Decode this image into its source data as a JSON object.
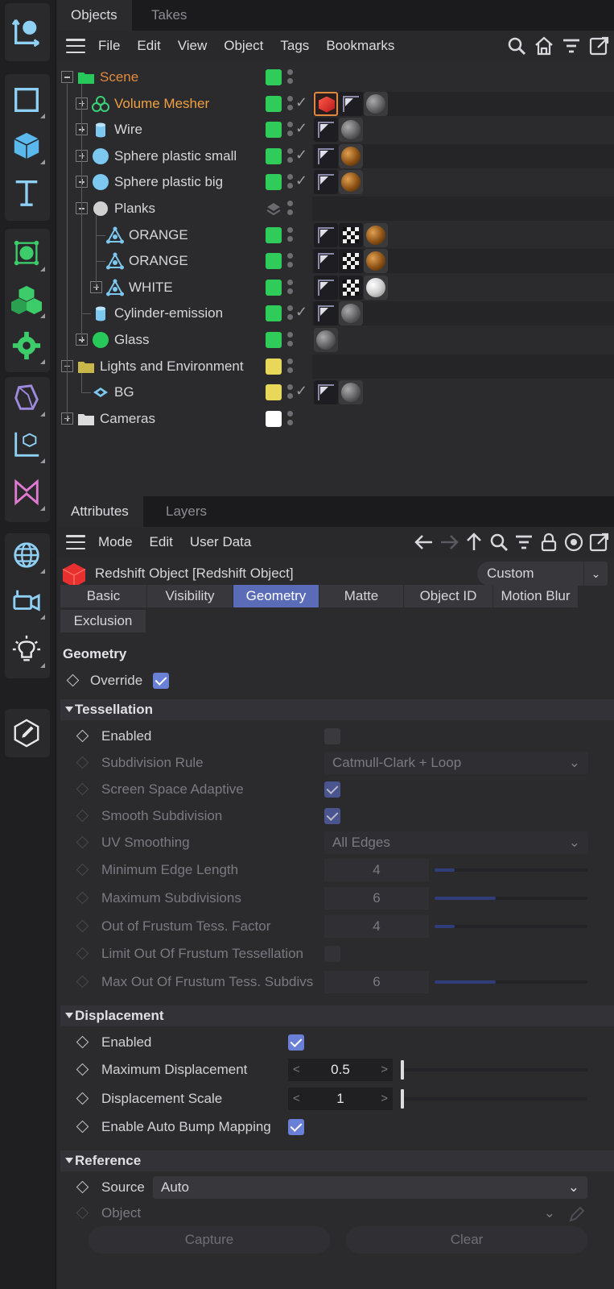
{
  "object_manager": {
    "tabs": [
      "Objects",
      "Takes"
    ],
    "menu": [
      "File",
      "Edit",
      "View",
      "Object",
      "Tags",
      "Bookmarks"
    ],
    "objects": [
      {
        "name": "Scene",
        "depth": 0,
        "expander": "minus",
        "icon": "folder-icon",
        "icon_color": "#27c95a",
        "name_color": "#e08a3c",
        "layer_color": "#2fcc5a",
        "check": false,
        "tags": [],
        "striped": false
      },
      {
        "name": "Volume Mesher",
        "depth": 1,
        "expander": "plus",
        "icon": "volume-mesher-icon",
        "icon_color": "#3cd07a",
        "name_color": "#f0a040",
        "layer_color": "#2fcc5a",
        "check": true,
        "tags": [
          "red-cube",
          "phong",
          "grey-material"
        ],
        "striped": true
      },
      {
        "name": "Wire",
        "depth": 1,
        "expander": "plus",
        "icon": "cylinder-icon",
        "icon_color": "#7cc8f0",
        "name_color": "#d6d6da",
        "layer_color": "#2fcc5a",
        "check": true,
        "tags": [
          "phong",
          "grey-material"
        ],
        "striped": false
      },
      {
        "name": "Sphere plastic small",
        "depth": 1,
        "expander": "plus",
        "icon": "sphere-icon",
        "icon_color": "#7cc8f0",
        "name_color": "#d6d6da",
        "layer_color": "#2fcc5a",
        "check": true,
        "tags": [
          "phong",
          "brown-material"
        ],
        "striped": true
      },
      {
        "name": "Sphere plastic big",
        "depth": 1,
        "expander": "plus",
        "icon": "sphere-icon",
        "icon_color": "#7cc8f0",
        "name_color": "#d6d6da",
        "layer_color": "#2fcc5a",
        "check": true,
        "tags": [
          "phong",
          "brown-material"
        ],
        "striped": false
      },
      {
        "name": "Planks",
        "depth": 1,
        "expander": "minus",
        "icon": "null-icon",
        "icon_color": "#d0d0d0",
        "name_color": "#d6d6da",
        "layer_color": "layers",
        "check": false,
        "tags": [],
        "striped": true
      },
      {
        "name": "ORANGE",
        "depth": 2,
        "expander": "none",
        "icon": "polygon-icon",
        "icon_color": "#7cc8f0",
        "name_color": "#d6d6da",
        "layer_color": "#2fcc5a",
        "check": false,
        "tags": [
          "phong",
          "checker",
          "brown-material"
        ],
        "striped": false
      },
      {
        "name": "ORANGE",
        "depth": 2,
        "expander": "none",
        "icon": "polygon-icon",
        "icon_color": "#7cc8f0",
        "name_color": "#d6d6da",
        "layer_color": "#2fcc5a",
        "check": false,
        "tags": [
          "phong",
          "checker",
          "brown-material"
        ],
        "striped": true
      },
      {
        "name": "WHITE",
        "depth": 2,
        "expander": "plus",
        "icon": "polygon-icon",
        "icon_color": "#7cc8f0",
        "name_color": "#d6d6da",
        "layer_color": "#2fcc5a",
        "check": false,
        "tags": [
          "phong",
          "checker",
          "white-material"
        ],
        "striped": false
      },
      {
        "name": "Cylinder-emission",
        "depth": 1,
        "expander": "none",
        "icon": "cylinder-icon",
        "icon_color": "#7cc8f0",
        "name_color": "#d6d6da",
        "layer_color": "#2fcc5a",
        "check": true,
        "tags": [
          "phong",
          "grey-material"
        ],
        "striped": true
      },
      {
        "name": "Glass",
        "depth": 1,
        "expander": "plus",
        "icon": "sphere-icon",
        "icon_color": "#27c95a",
        "name_color": "#d6d6da",
        "layer_color": "#2fcc5a",
        "check": false,
        "tags": [
          "grey-material"
        ],
        "striped": false
      },
      {
        "name": "Lights and Environment",
        "depth": 0,
        "expander": "minus",
        "icon": "folder-icon",
        "icon_color": "#c8b84a",
        "name_color": "#d6d6da",
        "layer_color": "#e8d85a",
        "check": false,
        "tags": [],
        "striped": true
      },
      {
        "name": "BG",
        "depth": 1,
        "expander": "none",
        "icon": "plane-icon",
        "icon_color": "#7cc8f0",
        "name_color": "#d6d6da",
        "layer_color": "#e8d85a",
        "check": true,
        "tags": [
          "phong",
          "grey-material"
        ],
        "striped": false
      },
      {
        "name": "Cameras",
        "depth": 0,
        "expander": "plus",
        "icon": "folder-icon",
        "icon_color": "#dcdcdc",
        "name_color": "#d6d6da",
        "layer_color": "#ffffff",
        "check": false,
        "tags": [],
        "striped": false
      }
    ]
  },
  "attributes": {
    "tabs": [
      "Attributes",
      "Layers"
    ],
    "menu": [
      "Mode",
      "Edit",
      "User Data"
    ],
    "object_title": "Redshift Object [Redshift Object]",
    "preset": "Custom",
    "prop_tabs": [
      "Basic",
      "Visibility",
      "Geometry",
      "Matte",
      "Object ID",
      "Motion Blur",
      "Exclusion"
    ],
    "active_prop_tab": "Geometry",
    "section_title": "Geometry",
    "override_label": "Override",
    "override_checked": true,
    "tessellation": {
      "title": "Tessellation",
      "enabled_label": "Enabled",
      "enabled": false,
      "subdivision_rule_label": "Subdivision Rule",
      "subdivision_rule": "Catmull-Clark + Loop",
      "screen_space_label": "Screen Space Adaptive",
      "screen_space": true,
      "smooth_label": "Smooth Subdivision",
      "smooth": true,
      "uv_smoothing_label": "UV Smoothing",
      "uv_smoothing": "All Edges",
      "min_edge_label": "Minimum Edge Length",
      "min_edge": "4",
      "min_edge_fill": 0.13,
      "max_subdiv_label": "Maximum Subdivisions",
      "max_subdiv": "6",
      "max_subdiv_fill": 0.4,
      "frustum_factor_label": "Out of Frustum Tess. Factor",
      "frustum_factor": "4",
      "frustum_factor_fill": 0.13,
      "limit_frustum_label": "Limit Out Of Frustum Tessellation",
      "limit_frustum": false,
      "max_frustum_label": "Max Out Of Frustum Tess. Subdivs",
      "max_frustum": "6",
      "max_frustum_fill": 0.4
    },
    "displacement": {
      "title": "Displacement",
      "enabled_label": "Enabled",
      "enabled": true,
      "max_disp_label": "Maximum Displacement",
      "max_disp": "0.5",
      "max_disp_fill": 0.0,
      "scale_label": "Displacement Scale",
      "scale": "1",
      "scale_fill": 0.0,
      "auto_bump_label": "Enable Auto Bump Mapping",
      "auto_bump": true
    },
    "reference": {
      "title": "Reference",
      "source_label": "Source",
      "source": "Auto",
      "object_label": "Object",
      "object": "",
      "capture_label": "Capture",
      "clear_label": "Clear"
    }
  },
  "toolbar_icons": [
    "coordinate-system-icon",
    "cube-outline-icon",
    "cube-icon",
    "text-icon",
    "subdivision-icon",
    "cloner-icon",
    "gear-deformer-icon",
    "field-icon",
    "axis-cube-icon",
    "spline-icon",
    "globe-icon",
    "camera-icon",
    "light-icon",
    "edit-icon"
  ]
}
